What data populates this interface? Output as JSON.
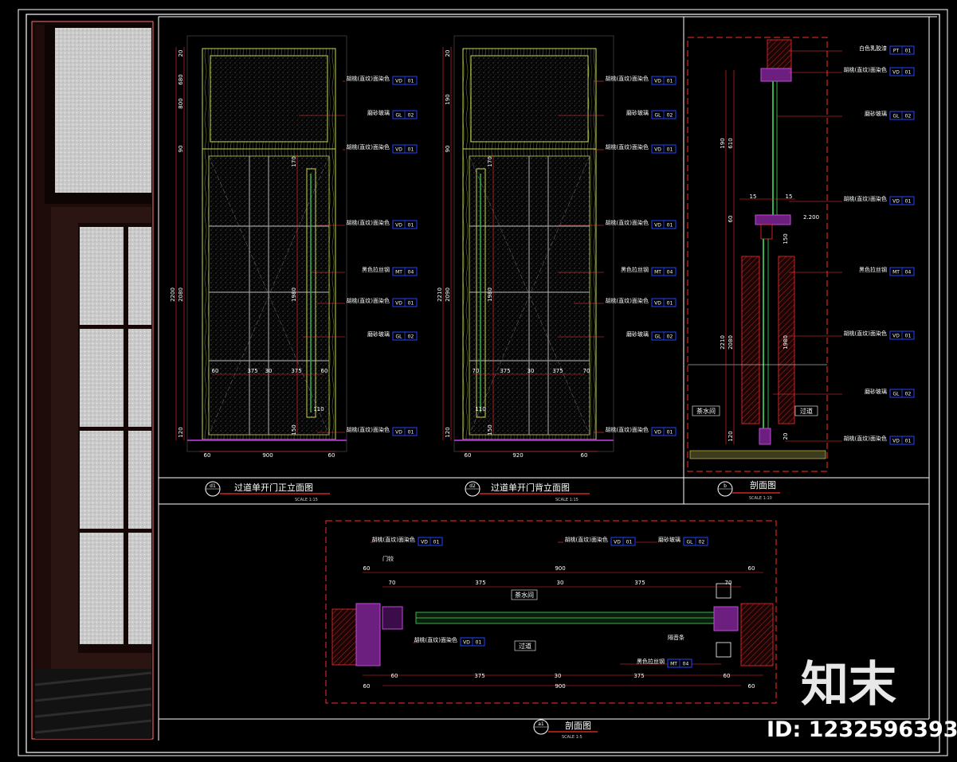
{
  "materials": {
    "walnut_veneer": "胡桃(直纹)面染色",
    "frosted_glass": "磨砂玻璃",
    "black_steel": "黑色拉丝钢",
    "white_paint": "白色乳胶漆",
    "hinge": "门铰",
    "seal_strip": "隔音条"
  },
  "codes": {
    "vd": "VD",
    "gl": "GL",
    "mt": "MT",
    "pt": "PT",
    "n01": "01",
    "n02": "02",
    "n04": "04"
  },
  "rooms": {
    "tea_room": "茶水间",
    "corridor": "过道"
  },
  "views": {
    "front": {
      "mark": "d1",
      "title": "过道单开门正立面图",
      "scale": "SCALE  1:15"
    },
    "back": {
      "mark": "d2",
      "title": "过道单开门背立面图",
      "scale": "SCALE  1:15"
    },
    "section_b": {
      "mark": "b",
      "title": "剖面图",
      "scale": "SCALE  1:10"
    },
    "section_a1": {
      "mark": "a1",
      "title": "剖面图",
      "scale": "SCALE  1:5"
    }
  },
  "dims": {
    "d20": "20",
    "d30": "30",
    "d40": "40",
    "d60": "60",
    "d70": "70",
    "d90": "90",
    "d110": "110",
    "d120": "120",
    "d150": "150",
    "d170": "170",
    "d190": "190",
    "d375": "375",
    "d610": "610",
    "d680": "680",
    "d800": "800",
    "d900": "900",
    "d920": "920",
    "d1980": "1980",
    "d2080": "2080",
    "d2090": "2090",
    "d2200": "2200",
    "d2210": "2210",
    "level": "2.200",
    "d15": "15"
  },
  "watermark": {
    "brand": "知末",
    "id": "ID: 1232596393"
  },
  "colors": {
    "frame": "#ffffff",
    "dim": "#ff2a2a",
    "veneer": "#c8d850",
    "glass_line": "#36b24a",
    "tag_box": "#2244ff",
    "steel": "#9a2eb8",
    "leader": "#ff3b3b",
    "photo_wood": "#2a1512",
    "photo_glass": "#cfcfcf"
  }
}
